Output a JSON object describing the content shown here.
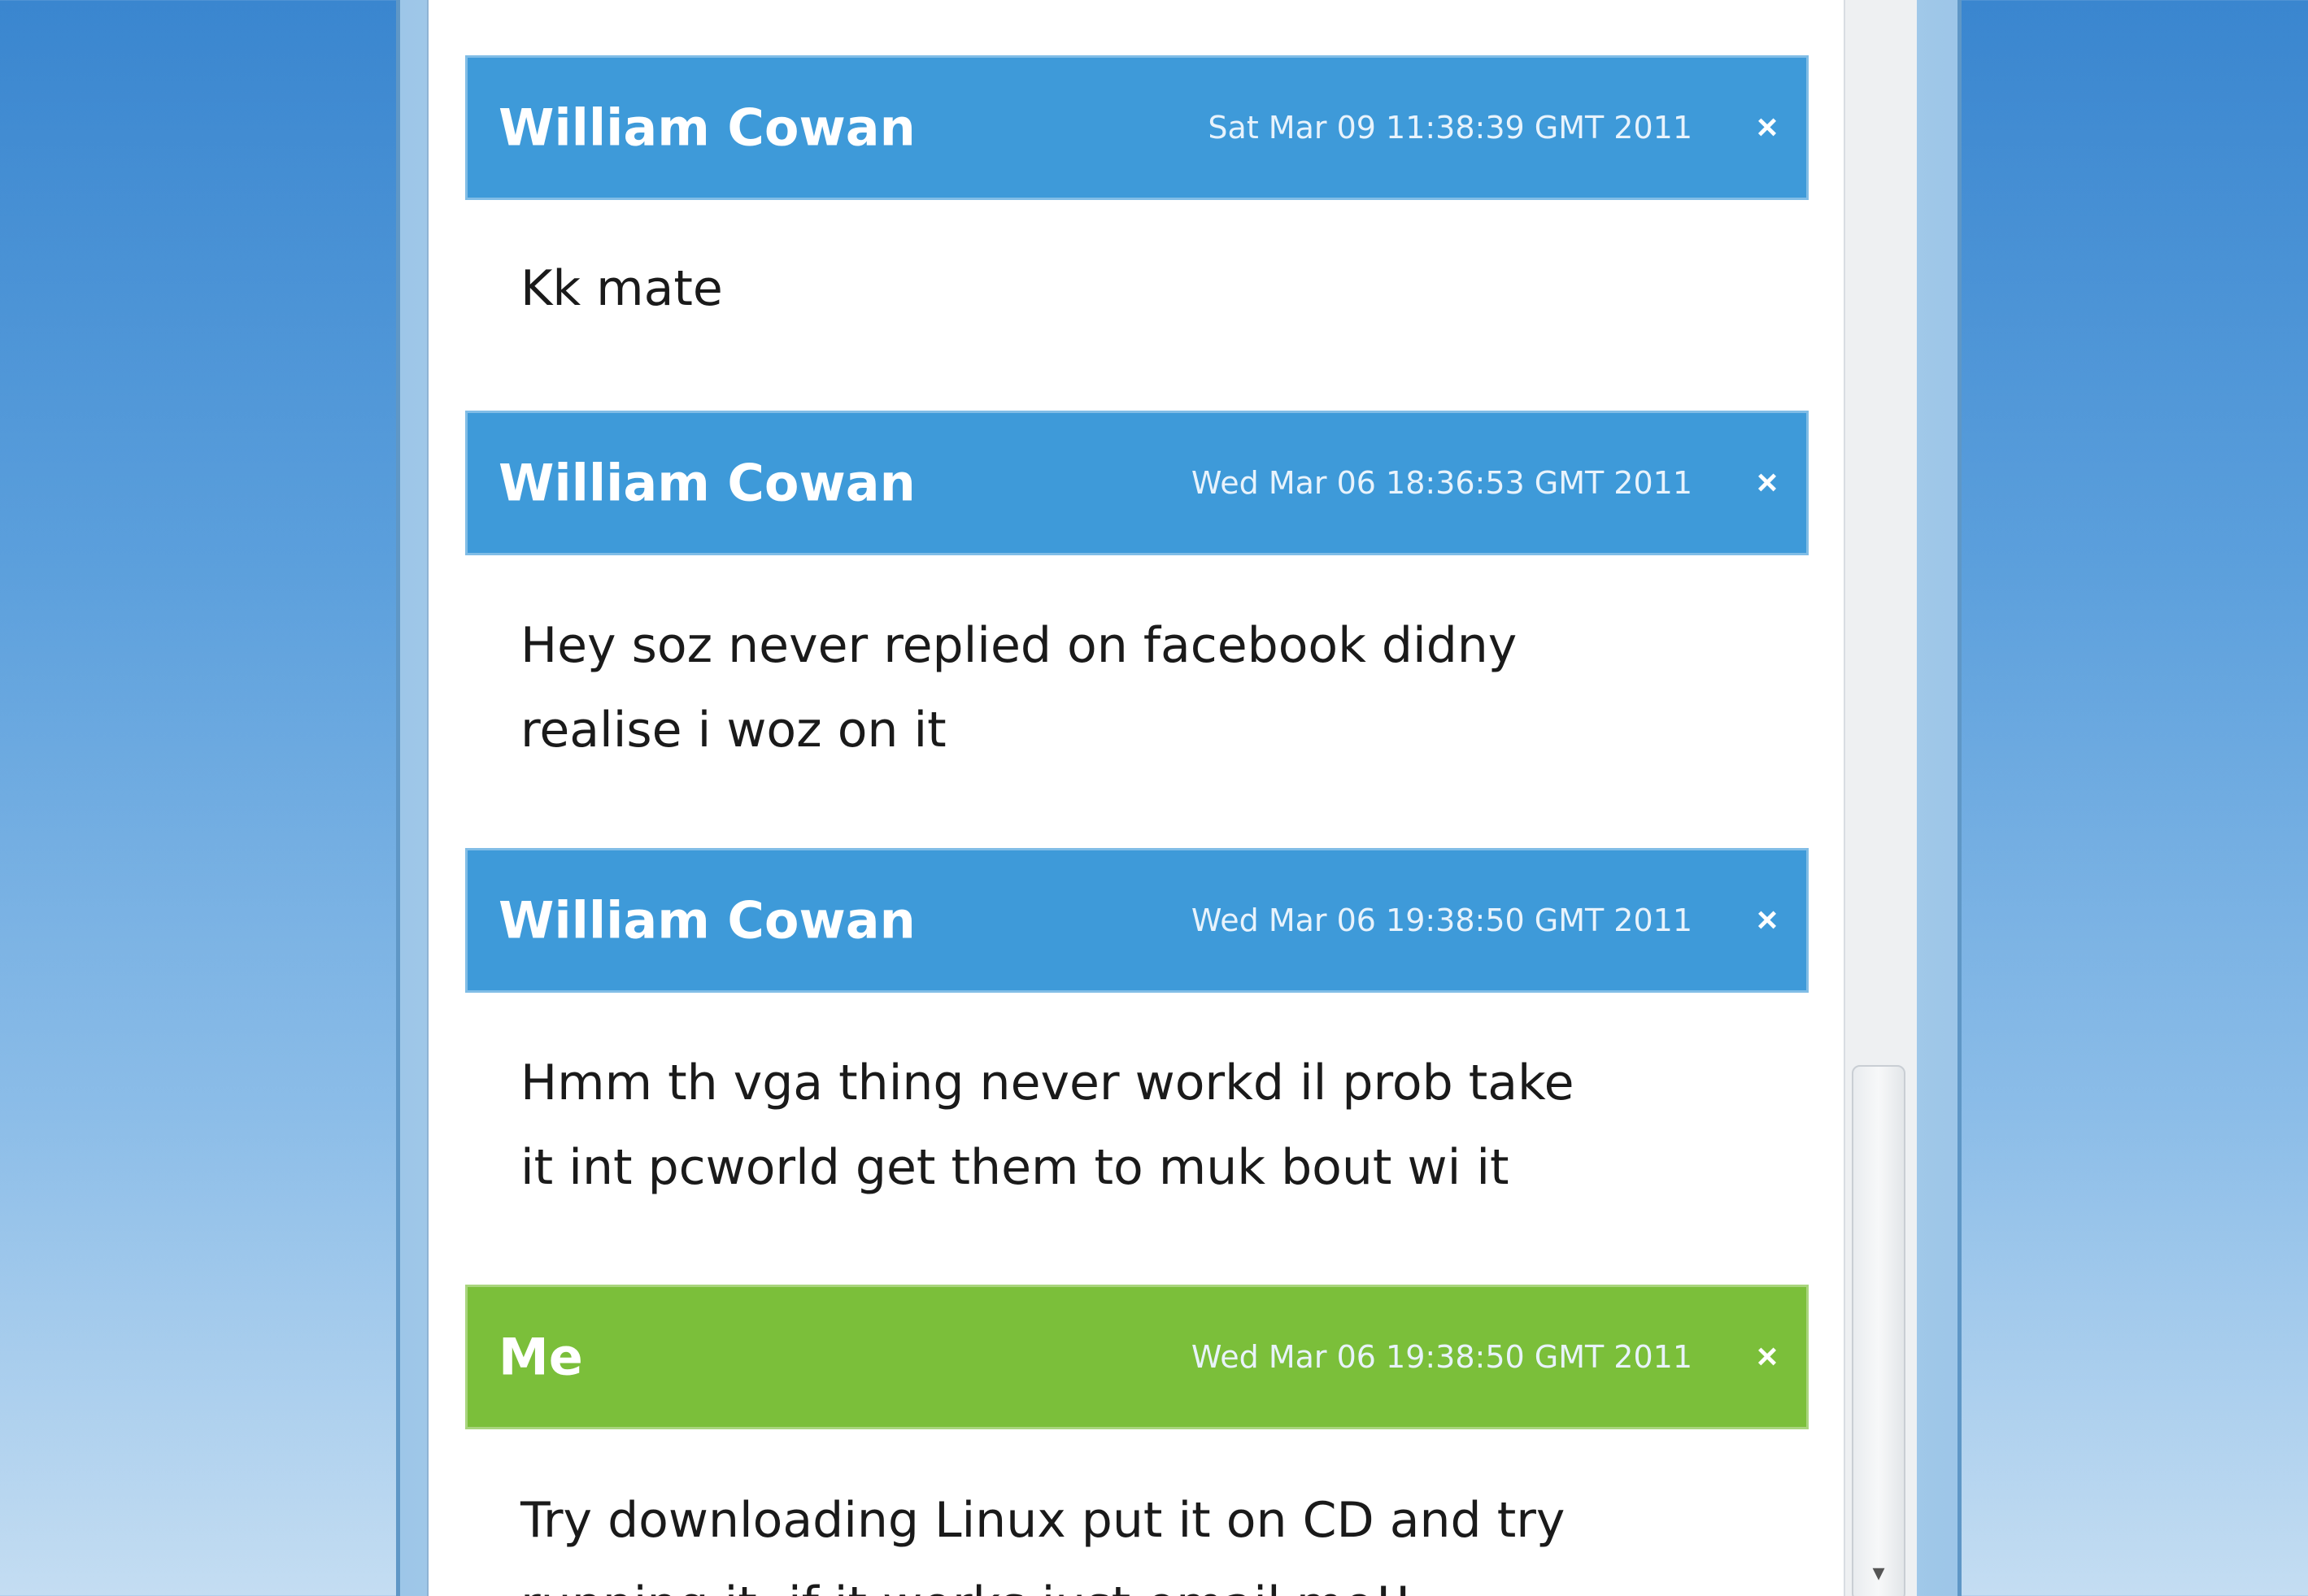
{
  "chat": {
    "messages": [
      {
        "sender": "William Cowan",
        "timestamp": "Sat Mar 09 11:38:39 GMT 2011",
        "text": "Kk mate",
        "color": "#3e9ad9"
      },
      {
        "sender": "William Cowan",
        "timestamp": "Wed Mar 06 18:36:53 GMT 2011",
        "text": "Hey soz never replied on facebook didny\nrealise i woz on it",
        "color": "#3e9ad9"
      },
      {
        "sender": "William Cowan",
        "timestamp": "Wed Mar 06 19:38:50 GMT 2011",
        "text": "Hmm th vga thing never workd il prob take\nit int pcworld get them to muk bout wi it",
        "color": "#3e9ad9"
      },
      {
        "sender": "Me",
        "timestamp": "Wed Mar 06 19:38:50 GMT 2011",
        "text": "Try downloading Linux put it on CD and try\nrunning it, if it works just email me!!",
        "color": "#7bbf3a"
      }
    ],
    "close_glyph": "×",
    "scroll_down_glyph": "▾",
    "accent_blue": "#3e9ad9",
    "accent_green": "#7bbf3a"
  }
}
